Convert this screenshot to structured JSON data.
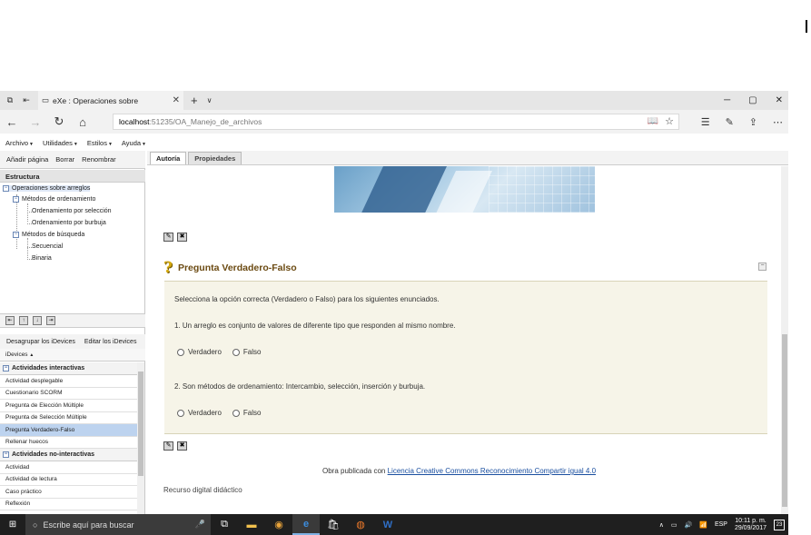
{
  "browser": {
    "tab_title": "eXe : Operaciones sobre",
    "tab_close": "✕",
    "new_tab": "+",
    "url_host": "localhost",
    "url_path": ":51235/OA_Manejo_de_archivos"
  },
  "menu": [
    {
      "label": "Archivo"
    },
    {
      "label": "Utilidades"
    },
    {
      "label": "Estilos"
    },
    {
      "label": "Ayuda"
    }
  ],
  "structure": {
    "toolbar": {
      "add": "Añadir página",
      "delete": "Borrar",
      "rename": "Renombrar"
    },
    "header": "Estructura",
    "tree": [
      {
        "label": "Operaciones sobre arreglos",
        "level": 0,
        "expander": "−"
      },
      {
        "label": "Métodos de ordenamiento",
        "level": 1,
        "expander": "−"
      },
      {
        "label": "Ordenamiento por selección",
        "level": 2
      },
      {
        "label": "Ordenamiento por burbuja",
        "level": 2
      },
      {
        "label": "Métodos de búsqueda",
        "level": 1,
        "expander": "−"
      },
      {
        "label": "Secuencial",
        "level": 2
      },
      {
        "label": "Binaria",
        "level": 2
      }
    ]
  },
  "idevices": {
    "toolbar": {
      "ungroup": "Desagrupar los iDevices",
      "edit": "Editar los iDevices"
    },
    "header": "iDevices",
    "header_arrow": "▲",
    "group_interactive": "Actividades interactivas",
    "interactive_items": [
      "Actividad desplegable",
      "Cuestionario SCORM",
      "Pregunta de Elección Múltiple",
      "Pregunta de Selección Múltiple",
      "Pregunta Verdadero-Falso",
      "Rellenar huecos"
    ],
    "group_noninteractive": "Actividades no-interactivas",
    "noninteractive_items": [
      "Actividad",
      "Actividad de lectura",
      "Caso práctico",
      "Reflexión"
    ]
  },
  "content_tabs": [
    "Autoría",
    "Propiedades"
  ],
  "idevice": {
    "icon": "?",
    "title": "Pregunta Verdadero-Falso",
    "instructions": "Selecciona la opción correcta (Verdadero o Falso) para los siguientes enunciados.",
    "questions": [
      {
        "text": "1. Un arreglo es conjunto de valores de diferente tipo que responden al mismo nombre."
      },
      {
        "text": "2. Son métodos de ordenamiento: Intercambio, selección, inserción y burbuja."
      }
    ],
    "true_label": "Verdadero",
    "false_label": "Falso"
  },
  "footer": {
    "credit_prefix": "Obra publicada con ",
    "license_link": "Licencia Creative Commons Reconocimiento Compartir igual 4.0",
    "resource": "Recurso digital didáctico"
  },
  "taskbar": {
    "search_placeholder": "Escribe aquí para buscar",
    "lang": "ESP",
    "time": "10:11 p. m.",
    "date": "29/09/2017",
    "notifications": "23"
  }
}
